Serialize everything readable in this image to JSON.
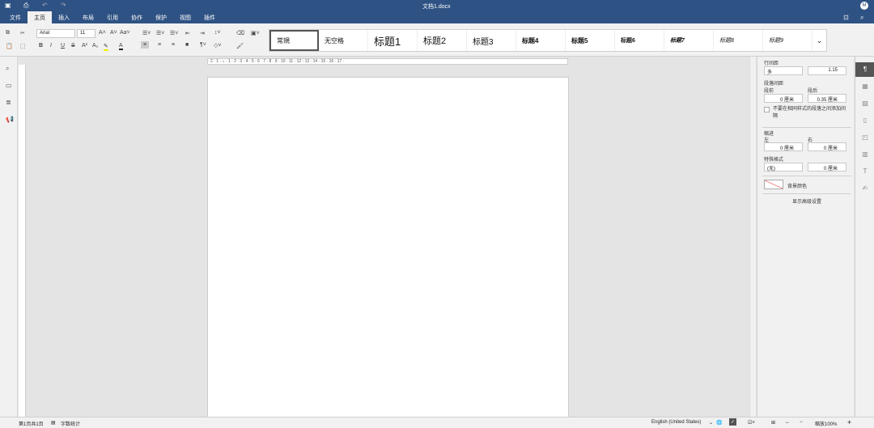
{
  "title": "文档1.docx",
  "avatar": "M",
  "menu": [
    "文件",
    "主页",
    "插入",
    "布局",
    "引用",
    "协作",
    "保护",
    "视图",
    "插件"
  ],
  "toolbar": {
    "font": "Arial",
    "size": "11"
  },
  "styles": [
    "常規",
    "无空格",
    "标题1",
    "标题2",
    "标题3",
    "标题4",
    "标题5",
    "标题6",
    "标题7",
    "标题8",
    "标题9"
  ],
  "ruler": "· 2 · 1 · ⌂ · 1 · 2 · 3 · 4 · 5 · 6 · 7 · 8 · 9 · 10 · 11 · 12 · 13 · 14 · 15 · 16 · 17 ·",
  "panel": {
    "line_spacing_label": "行间距",
    "line_spacing_mode": "多",
    "line_spacing_value": "1.15",
    "para_spacing_label": "段落间距",
    "before_label": "段前",
    "after_label": "段后",
    "before_value": "0 厘米",
    "after_value": "0.35 厘米",
    "no_space_same_style": "不要在相同样式的段落之间添加间隔",
    "indent_label": "缩进",
    "left_label": "左",
    "right_label": "右",
    "left_value": "0 厘米",
    "right_value": "0 厘米",
    "special_label": "特殊格式",
    "special_mode": "(无)",
    "special_value": "0 厘米",
    "bg_color_label": "背景颜色",
    "advanced": "显示高级设置"
  },
  "status": {
    "page": "第1页共1页",
    "word_count": "字数统计",
    "language": "English (United States)",
    "zoom": "缩放100%"
  }
}
